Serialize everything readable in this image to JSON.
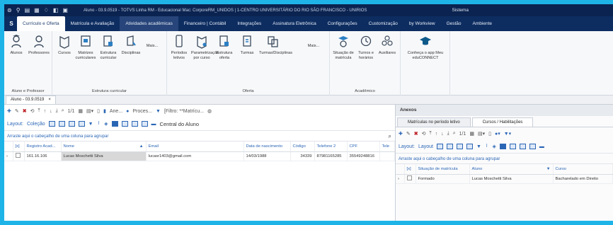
{
  "titlebar": {
    "window_title": "Aluno - 03.9.0519 - TOTVS Linha RM - Educacional  Mac: CorporeRM_UNIDOS | 1-CENTRO UNIVERSITÁRIO DO RIO SÃO FRANCISCO - UNIRIOS",
    "system_label": "Sistema"
  },
  "menubar": {
    "logo": "S",
    "tabs": [
      "Currículo e Oferta",
      "Matrícula e Avaliação",
      "Atividades acadêmicas",
      "Financeiro | Contábil",
      "Integrações",
      "Assinatura Eletrônica",
      "Configurações",
      "Customização",
      "by Workview",
      "Gestão",
      "Ambiente"
    ]
  },
  "ribbon": {
    "groups": [
      {
        "label": "Aluno e Professor",
        "buttons": [
          "Alunos",
          "Professores"
        ]
      },
      {
        "label": "Estrutura curricular",
        "buttons": [
          "Cursos",
          "Matrizes curriculares",
          "Estrutura curricular",
          "Disciplinas",
          "Mais..."
        ]
      },
      {
        "label": "Oferta",
        "buttons": [
          "Períodos letivos",
          "Parametrização por curso",
          "Estrutura oferta",
          "Turmas",
          "Turmas/Disciplinas",
          "Mais..."
        ]
      },
      {
        "label": "Acadêmico",
        "buttons": [
          "Situação de matrícula",
          "Turnos e horários",
          "Auxiliares"
        ]
      },
      {
        "label": "",
        "buttons": [
          "Conheça o app Meu eduCONNECT"
        ]
      }
    ]
  },
  "doc_tab": {
    "label": "Aluno - 03.9.0519",
    "close": "×"
  },
  "main": {
    "toolbar": {
      "annex": "Ane...",
      "process": "Proces...",
      "filter": "[Filtro: **Matrícu...",
      "page": "1/1"
    },
    "layout": {
      "label": "Layout:",
      "value": "Coleção",
      "view": "Central do Aluno"
    },
    "group_hint": "Arraste aqui o cabeçalho de uma coluna para agrupar",
    "columns": [
      "[x]",
      "Registro Acad...",
      "Nome",
      "Email",
      "Data de nascimento",
      "Código",
      "Telefone 2",
      "CPF",
      "Tele"
    ],
    "rows": [
      {
        "registro": "161.16.106",
        "nome": "Lucas Moschetti Silva",
        "email": "lucasr1403@gmail.com",
        "nascimento": "14/03/1988",
        "codigo": "34339",
        "telefone2": "87981165285",
        "cpf": "35549248816",
        "tele": ""
      }
    ]
  },
  "side": {
    "title": "Anexos",
    "tabs": [
      "Matrículas no período letivo",
      "Cursos / Habilitações"
    ],
    "toolbar": {
      "page": "1/1"
    },
    "layout": {
      "label": "Layout:",
      "value": "Layout"
    },
    "group_hint": "Arraste aqui o cabeçalho de uma coluna para agrupar",
    "columns": [
      "[x]",
      "Situação de matrícula",
      "Aluno",
      "Curso"
    ],
    "rows": [
      {
        "situacao": "Formado",
        "aluno": "Lucas Moschetti Silva",
        "curso": "Bacharelado em Direito"
      }
    ]
  },
  "colors": {
    "titlebar": "#0b2350",
    "menubar": "#0d2d61",
    "accent": "#2b66b5",
    "frame": "#1fb4e8"
  }
}
